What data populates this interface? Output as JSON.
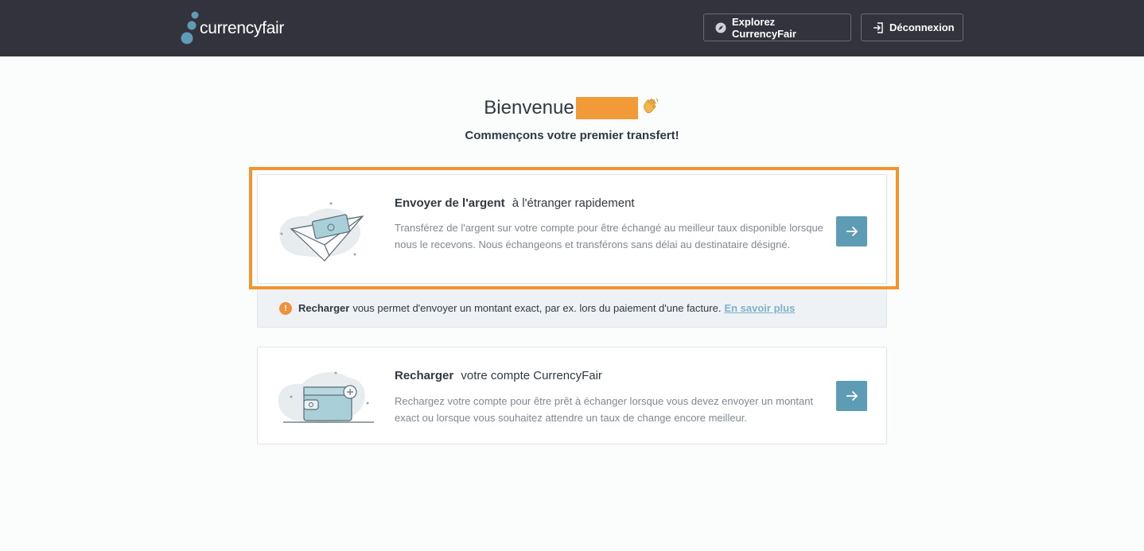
{
  "header": {
    "brand": "currencyfair",
    "explore_label": "Explorez CurrencyFair",
    "logout_label": "Déconnexion"
  },
  "welcome": {
    "title": "Bienvenue",
    "subtitle": "Commençons votre premier transfert!"
  },
  "cards": {
    "send": {
      "title_bold": "Envoyer de l'argent",
      "title_rest": "à l'étranger rapidement",
      "description": "Transférez de l'argent sur votre compte pour être échangé au meilleur taux disponible lorsque nous le recevons. Nous échangeons et transférons sans délai au destinataire désigné."
    },
    "recharge": {
      "title_bold": "Recharger",
      "title_rest": "votre compte CurrencyFair",
      "description": "Rechargez votre compte pour être prêt à échanger lorsque vous devez envoyer un montant exact ou lorsque vous souhaitez attendre un taux de change encore meilleur."
    }
  },
  "info": {
    "icon_text": "!",
    "bold": "Recharger",
    "text": "vous permet d'envoyer un montant exact, par ex. lors du paiement d'une facture.",
    "link": "En savoir plus"
  },
  "colors": {
    "header_bg": "#32333d",
    "accent": "#5e9cb5",
    "highlight": "#f2952f",
    "warning": "#f0923a"
  },
  "icons": {
    "explore": "compass-icon",
    "logout": "logout-icon",
    "wave": "waving-hand-icon",
    "send_illustration": "paper-plane-money-illustration",
    "recharge_illustration": "wallet-illustration",
    "arrow": "arrow-right-icon",
    "info": "exclamation-icon"
  }
}
